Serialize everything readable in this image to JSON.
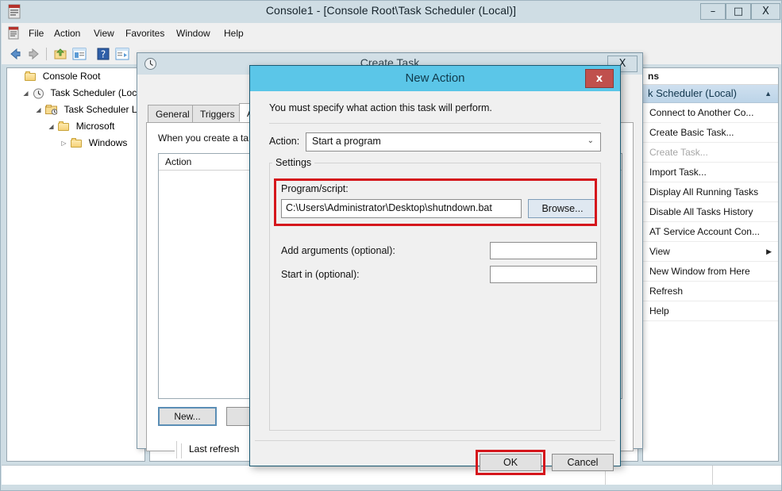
{
  "window": {
    "title": "Console1 - [Console Root\\Task Scheduler (Local)]",
    "app_icon": "mmc-console-icon",
    "controls": {
      "minimize": "–",
      "maximize": "□",
      "close": "X"
    },
    "doc_controls": {
      "minimize": "–",
      "restore": "❐",
      "close": "✕"
    }
  },
  "menubar": {
    "icon": "mmc-console-icon",
    "items": [
      "File",
      "Action",
      "View",
      "Favorites",
      "Window",
      "Help"
    ]
  },
  "toolbar": {
    "items": [
      {
        "name": "back-arrow-icon",
        "glyph": "←"
      },
      {
        "name": "forward-arrow-icon",
        "glyph": "→"
      },
      {
        "name": "up-folder-icon",
        "glyph": "↑"
      },
      {
        "name": "show-hide-tree-icon",
        "glyph": "▤"
      },
      {
        "name": "help-icon",
        "glyph": "?"
      },
      {
        "name": "properties-icon",
        "glyph": "▥"
      }
    ]
  },
  "tree": {
    "items": [
      {
        "label": "Console Root",
        "indent": 8,
        "twisty": "",
        "icon": "folder-icon"
      },
      {
        "label": "Task Scheduler (Local)",
        "indent": 18,
        "twisty": "◢",
        "icon": "clock-icon"
      },
      {
        "label": "Task Scheduler Lib",
        "indent": 34,
        "twisty": "◢",
        "icon": "folder-clock-icon"
      },
      {
        "label": "Microsoft",
        "indent": 50,
        "twisty": "◢",
        "icon": "folder-icon"
      },
      {
        "label": "Windows",
        "indent": 66,
        "twisty": "▷",
        "icon": "folder-icon"
      }
    ]
  },
  "actions_pane": {
    "header": "ns",
    "group_title": "k Scheduler (Local)",
    "group_chevron": "▲",
    "items": [
      {
        "label": "Connect to Another Co...",
        "disabled": false,
        "submenu": false
      },
      {
        "label": "Create Basic Task...",
        "disabled": false,
        "submenu": false
      },
      {
        "label": "Create Task...",
        "disabled": true,
        "submenu": false
      },
      {
        "label": "Import Task...",
        "disabled": false,
        "submenu": false
      },
      {
        "label": "Display All Running Tasks",
        "disabled": false,
        "submenu": false
      },
      {
        "label": "Disable All Tasks History",
        "disabled": false,
        "submenu": false
      },
      {
        "label": "AT Service Account Con...",
        "disabled": false,
        "submenu": false
      },
      {
        "label": "View",
        "disabled": false,
        "submenu": true
      },
      {
        "label": "New Window from Here",
        "disabled": false,
        "submenu": false
      },
      {
        "label": "Refresh",
        "disabled": false,
        "submenu": false
      },
      {
        "label": "Help",
        "disabled": false,
        "submenu": false
      }
    ],
    "submenu_arrow": "▶"
  },
  "create_task": {
    "title": "Create Task",
    "icon": "clock-icon",
    "close": "X",
    "tabs": [
      {
        "label": "General",
        "active": false
      },
      {
        "label": "Triggers",
        "active": false
      },
      {
        "label": "Ac",
        "active": true
      }
    ],
    "description": "When you create a ta",
    "list_header": "Action",
    "buttons": [
      {
        "label": "New...",
        "focus": true
      },
      {
        "label": "E",
        "focus": false
      }
    ],
    "status_text": "Last refresh"
  },
  "new_action_dialog": {
    "title": "New Action",
    "close": "x",
    "instruction": "You must specify what action this task will perform.",
    "action_label": "Action:",
    "action_value": "Start a program",
    "action_chevron": "⌄",
    "settings_legend": "Settings",
    "program_label": "Program/script:",
    "program_value": "C:\\Users\\Administrator\\Desktop\\shutndown.bat",
    "browse_label": "Browse...",
    "arguments_label": "Add arguments (optional):",
    "arguments_value": "",
    "start_in_label": "Start in (optional):",
    "start_in_value": "",
    "ok_label": "OK",
    "cancel_label": "Cancel",
    "highlight_color": "#d5161c",
    "titlebar_color": "#5bc6e8",
    "close_color": "#c0504d"
  },
  "statusbar": {
    "text": ""
  }
}
